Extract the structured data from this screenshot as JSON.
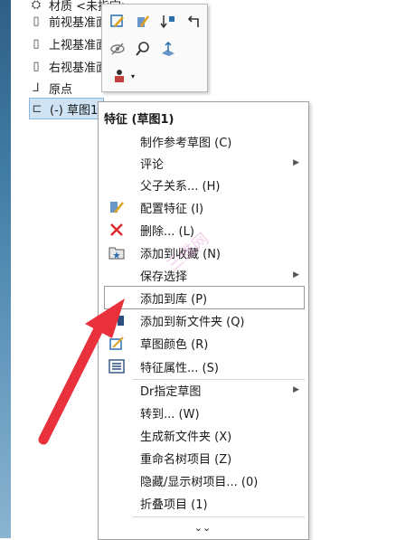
{
  "tree": {
    "items": [
      {
        "icon": "material-icon",
        "label": "材质 <未指定>"
      },
      {
        "icon": "plane-icon",
        "label": "前视基准面"
      },
      {
        "icon": "plane-icon",
        "label": "上视基准面"
      },
      {
        "icon": "plane-icon",
        "label": "右视基准面"
      },
      {
        "icon": "origin-icon",
        "label": "原点"
      },
      {
        "icon": "sketch-icon",
        "label": "(-) 草图1"
      }
    ]
  },
  "menu": {
    "header": "特征 (草图1)",
    "items": [
      {
        "label": "制作参考草图 (C)",
        "icon": "",
        "submenu": false
      },
      {
        "label": "评论",
        "icon": "",
        "submenu": true
      },
      {
        "label": "父子关系... (H)",
        "icon": "",
        "submenu": false
      },
      {
        "label": "配置特征 (I)",
        "icon": "config-icon",
        "submenu": false
      },
      {
        "label": "删除... (L)",
        "icon": "delete-icon",
        "submenu": false
      },
      {
        "label": "添加到收藏 (N)",
        "icon": "favorite-icon",
        "submenu": false
      },
      {
        "label": "保存选择",
        "icon": "",
        "submenu": true
      },
      {
        "label": "添加到库 (P)",
        "icon": "",
        "submenu": false
      },
      {
        "label": "添加到新文件夹 (Q)",
        "icon": "folder-icon",
        "submenu": false
      },
      {
        "label": "草图颜色 (R)",
        "icon": "color-icon",
        "submenu": false
      },
      {
        "label": "特征属性... (S)",
        "icon": "properties-icon",
        "submenu": false
      },
      {
        "label": "Dr指定草图",
        "icon": "",
        "submenu": true
      },
      {
        "label": "转到... (W)",
        "icon": "",
        "submenu": false
      },
      {
        "label": "生成新文件夹 (X)",
        "icon": "",
        "submenu": false
      },
      {
        "label": "重命名树项目 (Z)",
        "icon": "",
        "submenu": false
      },
      {
        "label": "隐藏/显示树项目... (0)",
        "icon": "",
        "submenu": false
      },
      {
        "label": "折叠项目 (1)",
        "icon": "",
        "submenu": false
      }
    ],
    "more": "⌄⌄"
  },
  "watermark": "三维网",
  "colors": {
    "accent": "#e8313b",
    "selection": "#cfe3f5"
  }
}
